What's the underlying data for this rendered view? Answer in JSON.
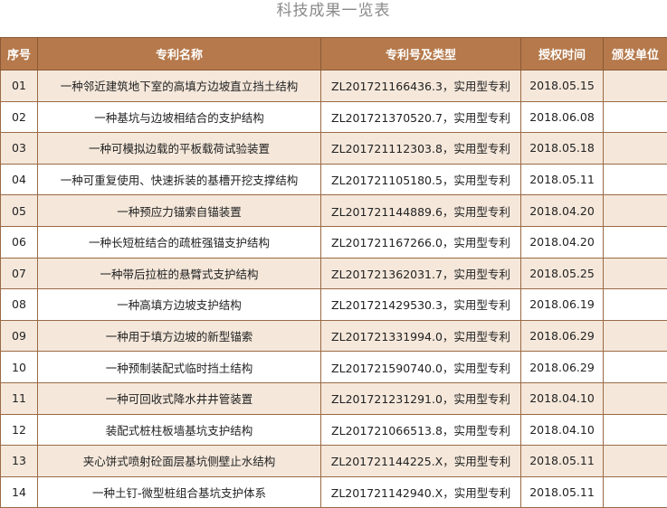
{
  "title": "科技成果一览表",
  "headers": [
    "序号",
    "专利名称",
    "专利号及类型",
    "授权时间",
    "颁发单位"
  ],
  "rows": [
    {
      "no": "01",
      "name": "一种邻近建筑地下室的高填方边坡直立挡土结构",
      "patent": "ZL201721166436.3，实用型专利",
      "date": "2018.05.15",
      "issuer": ""
    },
    {
      "no": "02",
      "name": "一种基坑与边坡相结合的支护结构",
      "patent": "ZL201721370520.7，实用型专利",
      "date": "2018.06.08",
      "issuer": ""
    },
    {
      "no": "03",
      "name": "一种可模拟边载的平板载荷试验装置",
      "patent": "ZL201721112303.8，实用型专利",
      "date": "2018.05.18",
      "issuer": ""
    },
    {
      "no": "04",
      "name": "一种可重复使用、快速拆装的基槽开挖支撑结构",
      "patent": "ZL201721105180.5，实用型专利",
      "date": "2018.05.11",
      "issuer": ""
    },
    {
      "no": "05",
      "name": "一种预应力锚索自锚装置",
      "patent": "ZL201721144889.6，实用型专利",
      "date": "2018.04.20",
      "issuer": ""
    },
    {
      "no": "06",
      "name": "一种长短桩结合的疏桩强锚支护结构",
      "patent": "ZL201721167266.0，实用型专利",
      "date": "2018.04.20",
      "issuer": ""
    },
    {
      "no": "07",
      "name": "一种带后拉桩的悬臂式支护结构",
      "patent": "ZL201721362031.7，实用型专利",
      "date": "2018.05.25",
      "issuer": ""
    },
    {
      "no": "08",
      "name": "一种高填方边坡支护结构",
      "patent": "ZL201721429530.3，实用型专利",
      "date": "2018.06.19",
      "issuer": ""
    },
    {
      "no": "09",
      "name": "一种用于填方边坡的新型锚索",
      "patent": "ZL201721331994.0，实用型专利",
      "date": "2018.06.29",
      "issuer": ""
    },
    {
      "no": "10",
      "name": "一种预制装配式临时挡土结构",
      "patent": "ZL201721590740.0，实用型专利",
      "date": "2018.06.29",
      "issuer": ""
    },
    {
      "no": "11",
      "name": "一种可回收式降水井井管装置",
      "patent": "ZL201721231291.0，实用型专利",
      "date": "2018.04.10",
      "issuer": ""
    },
    {
      "no": "12",
      "name": "装配式桩柱板墙基坑支护结构",
      "patent": "ZL201721066513.8，实用型专利",
      "date": "2018.04.10",
      "issuer": ""
    },
    {
      "no": "13",
      "name": "夹心饼式喷射砼面层基坑侧壁止水结构",
      "patent": "ZL201721144225.X，实用型专利",
      "date": "2018.05.11",
      "issuer": ""
    },
    {
      "no": "14",
      "name": "一种土钉-微型桩组合基坑支护体系",
      "patent": "ZL201721142940.X，实用型专利",
      "date": "2018.05.11",
      "issuer": ""
    }
  ],
  "colors": {
    "header_bg": "#b5794b",
    "stripe_bg": "#f5e8db",
    "border": "#9a6a45"
  }
}
